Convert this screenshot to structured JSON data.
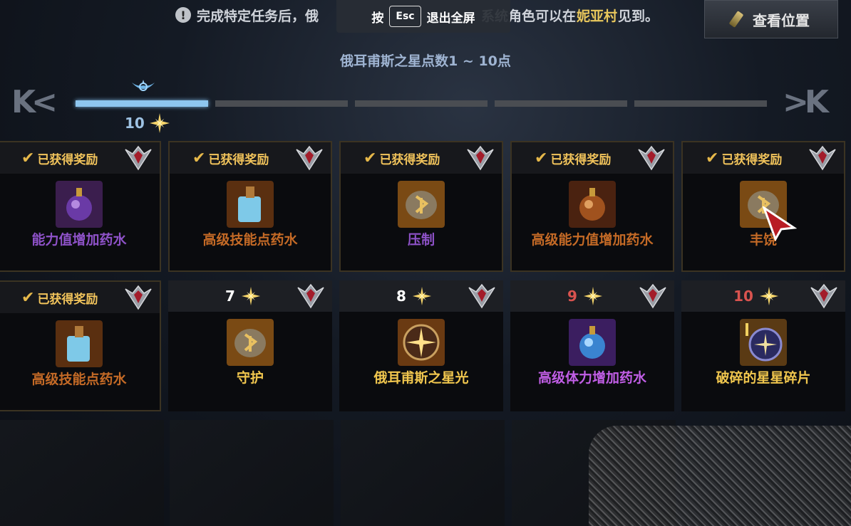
{
  "notice": {
    "text_before": "完成特定任务后，俄",
    "text_mid": "系统角色可以在",
    "village": "妮亚村",
    "text_after": "见到。"
  },
  "esc_overlay": {
    "press": "按",
    "key": "Esc",
    "action": "退出全屏"
  },
  "location_button": "查看位置",
  "range_title": "俄耳甫斯之星点数1 ~ 10点",
  "progress": {
    "current_points": "10",
    "segments_total": 5,
    "segments_filled": 1
  },
  "claimed_text": "已获得奖励",
  "rewards": [
    {
      "name": "能力值增加药水",
      "points": null,
      "claimed": true,
      "name_color": "#8e52c8",
      "icon": "purple-potion-icon"
    },
    {
      "name": "高级技能点药水",
      "points": null,
      "claimed": true,
      "name_color": "#c46a26",
      "icon": "blue-bottle-icon"
    },
    {
      "name": "压制",
      "points": null,
      "claimed": true,
      "name_color": "#8e52c8",
      "icon": "rune-stone-icon"
    },
    {
      "name": "高级能力值增加药水",
      "points": null,
      "claimed": true,
      "name_color": "#c46a26",
      "icon": "orange-potion-icon"
    },
    {
      "name": "丰饶",
      "points": null,
      "claimed": true,
      "name_color": "#c46a26",
      "icon": "rune-stone-icon"
    },
    {
      "name": "高级技能点药水",
      "points": null,
      "claimed": true,
      "name_color": "#c46a26",
      "icon": "blue-bottle-icon"
    },
    {
      "name": "守护",
      "points": "7",
      "claimed": false,
      "name_color": "#f0c64e",
      "icon": "rune-stone-icon",
      "points_color": "#ffffff"
    },
    {
      "name": "俄耳甫斯之星光",
      "points": "8",
      "claimed": false,
      "name_color": "#f0c64e",
      "icon": "star-orb-icon",
      "points_color": "#ffffff"
    },
    {
      "name": "高级体力增加药水",
      "points": "9",
      "claimed": false,
      "name_color": "#c15ee6",
      "icon": "blue-potion-icon",
      "points_color": "#d9534f"
    },
    {
      "name": "破碎的星星碎片",
      "points": "10",
      "claimed": false,
      "name_color": "#f0c64e",
      "icon": "star-fragment-icon",
      "points_color": "#d9534f"
    }
  ]
}
